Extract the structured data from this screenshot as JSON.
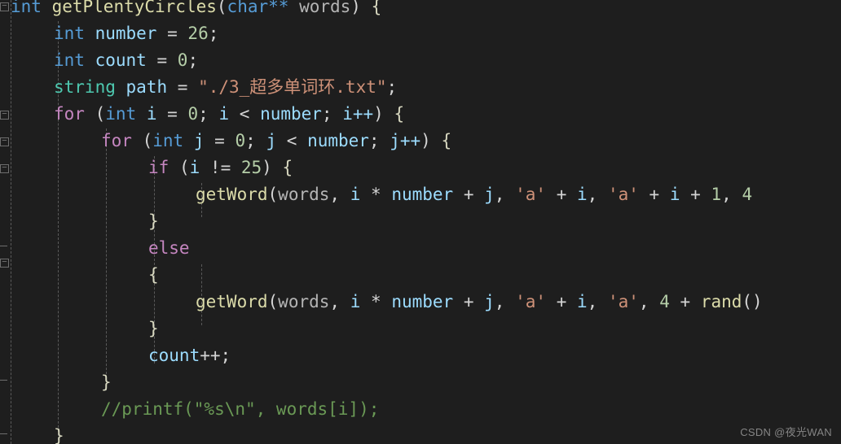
{
  "editor": {
    "background_color": "#1e1e1e",
    "font_size_px": 21,
    "line_height_px": 33,
    "language": "cpp",
    "clipped_right_edge": true,
    "theme_colors": {
      "keyword": "#569cd6",
      "control": "#c586c0",
      "type": "#4ec9b0",
      "function": "#dcdcaa",
      "variable": "#9cdcfe",
      "parameter": "#b4b4b4",
      "string": "#ce9178",
      "number": "#b5cea8",
      "comment": "#6a9955",
      "punctuation": "#d4d4d4",
      "indent_guide": "#5a5a5a",
      "fold_marker": "#6e6e6e"
    }
  },
  "code_lines": [
    {
      "indent": 0,
      "text": "int getPlentyCircles(char** words) {"
    },
    {
      "indent": 1,
      "text": "int number = 26;"
    },
    {
      "indent": 1,
      "text": "int count = 0;"
    },
    {
      "indent": 1,
      "text": "string path = \"./3_超多单词环.txt\";"
    },
    {
      "indent": 1,
      "text": "for (int i = 0; i < number; i++) {"
    },
    {
      "indent": 2,
      "text": "for (int j = 0; j < number; j++) {"
    },
    {
      "indent": 3,
      "text": "if (i != 25) {"
    },
    {
      "indent": 4,
      "text": "getWord(words, i * number + j, 'a' + i, 'a' + i + 1, 4"
    },
    {
      "indent": 3,
      "text": "}"
    },
    {
      "indent": 3,
      "text": "else"
    },
    {
      "indent": 3,
      "text": "{"
    },
    {
      "indent": 4,
      "text": "getWord(words, i * number + j, 'a' + i, 'a', 4 + rand()"
    },
    {
      "indent": 3,
      "text": "}"
    },
    {
      "indent": 3,
      "text": "count++;"
    },
    {
      "indent": 2,
      "text": "}"
    },
    {
      "indent": 2,
      "text": "//printf(\"%s\\n\", words[i]);"
    },
    {
      "indent": 1,
      "text": "}"
    }
  ],
  "tokens": {
    "line1": {
      "ret_type": "int",
      "fn_name": "getPlentyCircles",
      "open_paren": "(",
      "arg_type": "char**",
      "arg_name": "words",
      "close_paren": ")",
      "brace": "{"
    },
    "line2": {
      "type": "int",
      "name": "number",
      "assign": "=",
      "value": "26",
      "semi": ";"
    },
    "line3": {
      "type": "int",
      "name": "count",
      "assign": "=",
      "value": "0",
      "semi": ";"
    },
    "line4": {
      "type": "string",
      "name": "path",
      "assign": "=",
      "value": "\"./3_超多单词环.txt\"",
      "semi": ";"
    },
    "line5": {
      "kw": "for",
      "open": "(",
      "type": "int",
      "var": "i",
      "assign": "=",
      "init": "0",
      "semi1": ";",
      "cond_var": "i",
      "lt": "<",
      "cond_limit": "number",
      "semi2": ";",
      "inc": "i++",
      "close": ")",
      "brace": "{"
    },
    "line6": {
      "kw": "for",
      "open": "(",
      "type": "int",
      "var": "j",
      "assign": "=",
      "init": "0",
      "semi1": ";",
      "cond_var": "j",
      "lt": "<",
      "cond_limit": "number",
      "semi2": ";",
      "inc": "j++",
      "close": ")",
      "brace": "{"
    },
    "line7": {
      "kw": "if",
      "open": "(",
      "var": "i",
      "op": "!=",
      "num": "25",
      "close": ")",
      "brace": "{"
    },
    "line8": {
      "fn": "getWord",
      "open": "(",
      "a1": "words",
      "a2_i": "i",
      "a2_mul": "*",
      "a2_number": "number",
      "a2_plus": "+",
      "a2_j": "j",
      "a3_char": "'a'",
      "a3_plus": "+",
      "a3_i": "i",
      "a4_char": "'a'",
      "a4_plus1": "+",
      "a4_i": "i",
      "a4_plus2": "+",
      "a4_one": "1",
      "a5": "4"
    },
    "line9": {
      "brace": "}"
    },
    "line10": {
      "kw": "else"
    },
    "line11": {
      "brace": "{"
    },
    "line12": {
      "fn": "getWord",
      "open": "(",
      "a1": "words",
      "a2_i": "i",
      "a2_mul": "*",
      "a2_number": "number",
      "a2_plus": "+",
      "a2_j": "j",
      "a3_char": "'a'",
      "a3_plus": "+",
      "a3_i": "i",
      "a4_char": "'a'",
      "a5_num": "4",
      "a5_plus": "+",
      "a5_fn": "rand",
      "a5_open": "(",
      "a5_close": ")"
    },
    "line13": {
      "brace": "}"
    },
    "line14": {
      "var": "count",
      "inc": "++",
      "semi": ";"
    },
    "line15": {
      "brace": "}"
    },
    "line16": {
      "comment": "//printf(\"%s\\n\", words[i]);"
    },
    "line17": {
      "brace": "}"
    }
  },
  "fold_markers": [
    {
      "line": 1,
      "type": "box"
    },
    {
      "line": 5,
      "type": "box"
    },
    {
      "line": 6,
      "type": "box"
    },
    {
      "line": 7,
      "type": "box"
    },
    {
      "line": 10,
      "type": "dash"
    },
    {
      "line": 11,
      "type": "box"
    },
    {
      "line": 15,
      "type": "dash"
    },
    {
      "line": 17,
      "type": "dash"
    }
  ],
  "watermark": {
    "text": "CSDN @夜光WAN"
  }
}
